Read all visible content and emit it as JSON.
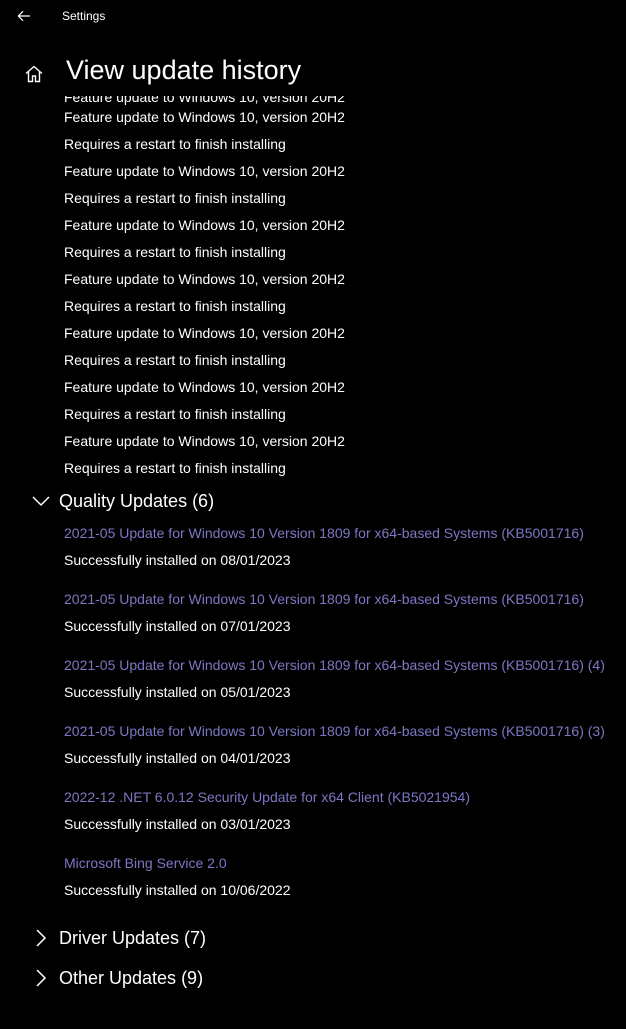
{
  "titlebar": {
    "app_title": "Settings"
  },
  "header": {
    "page_title": "View update history"
  },
  "feature_updates": {
    "clipped_line": "Feature update to Windows 10, version 20H2",
    "items": [
      {
        "name": "Feature update to Windows 10, version 20H2",
        "status": "Requires a restart to finish installing"
      },
      {
        "name": "Feature update to Windows 10, version 20H2",
        "status": "Requires a restart to finish installing"
      },
      {
        "name": "Feature update to Windows 10, version 20H2",
        "status": "Requires a restart to finish installing"
      },
      {
        "name": "Feature update to Windows 10, version 20H2",
        "status": "Requires a restart to finish installing"
      },
      {
        "name": "Feature update to Windows 10, version 20H2",
        "status": "Requires a restart to finish installing"
      },
      {
        "name": "Feature update to Windows 10, version 20H2",
        "status": "Requires a restart to finish installing"
      },
      {
        "name": "Feature update to Windows 10, version 20H2",
        "status": "Requires a restart to finish installing"
      }
    ]
  },
  "quality_updates": {
    "label": "Quality Updates (6)",
    "expanded": true,
    "items": [
      {
        "name": "2021-05 Update for Windows 10 Version 1809 for x64-based Systems (KB5001716)",
        "status": "Successfully installed on 08/01/2023"
      },
      {
        "name": "2021-05 Update for Windows 10 Version 1809 for x64-based Systems (KB5001716)",
        "status": "Successfully installed on 07/01/2023"
      },
      {
        "name": "2021-05 Update for Windows 10 Version 1809 for x64-based Systems (KB5001716) (4)",
        "status": "Successfully installed on 05/01/2023"
      },
      {
        "name": "2021-05 Update for Windows 10 Version 1809 for x64-based Systems (KB5001716) (3)",
        "status": "Successfully installed on 04/01/2023"
      },
      {
        "name": "2022-12 .NET 6.0.12 Security Update for x64 Client (KB5021954)",
        "status": "Successfully installed on 03/01/2023"
      },
      {
        "name": "Microsoft Bing Service 2.0",
        "status": "Successfully installed on 10/06/2022"
      }
    ]
  },
  "driver_updates": {
    "label": "Driver Updates (7)",
    "expanded": false
  },
  "other_updates": {
    "label": "Other Updates (9)",
    "expanded": false
  },
  "colors": {
    "background": "#000000",
    "text": "#ffffff",
    "link": "#7d77c4"
  },
  "icons": {
    "back": "back-arrow-icon",
    "home": "home-icon",
    "expanded": "chevron-down-icon",
    "collapsed": "chevron-right-icon"
  }
}
